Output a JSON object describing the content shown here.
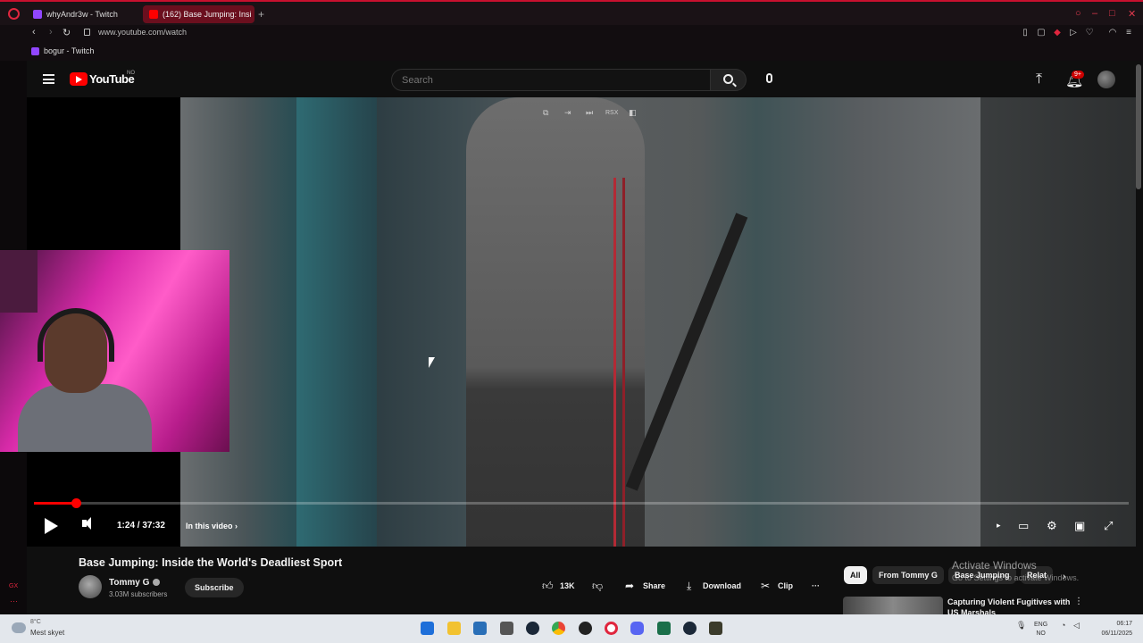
{
  "browser": {
    "tabs": [
      {
        "label": "whyAndr3w - Twitch"
      },
      {
        "label": "(162) Base Jumping: Insi"
      }
    ],
    "new_tab": "+",
    "url": "www.youtube.com/watch",
    "bookmark": "bogur - Twitch",
    "sidebar_gx": "GX",
    "sidebar_more": "···"
  },
  "youtube": {
    "logo_text": "YouTube",
    "country": "NO",
    "search_placeholder": "Search",
    "notif_badge": "9+"
  },
  "player": {
    "overlay_label": "RSX",
    "time": "1:24 / 37:32",
    "chapter": "In this video",
    "progress_fraction": 0.038,
    "accent": "#ff0000"
  },
  "video": {
    "title": "Base Jumping: Inside the World's Deadliest Sport",
    "channel": "Tommy G",
    "subscribers": "3.03M subscribers",
    "subscribe_label": "Subscribe",
    "actions": {
      "likes": "13K",
      "share": "Share",
      "download": "Download",
      "clip": "Clip",
      "more": "···"
    }
  },
  "recommendations": {
    "chips": [
      "All",
      "From Tommy G",
      "Base Jumping",
      "Relat"
    ],
    "first_title": "Capturing Violent Fugitives with US Marshals"
  },
  "watermark": {
    "title": "Activate Windows",
    "subtitle": "Go to Settings to activate Windows."
  },
  "taskbar": {
    "temp": "8°C",
    "weather": "Mest skyet",
    "lang_top": "ENG",
    "lang_bottom": "NO",
    "time": "06:17",
    "date": "06/11/2025"
  }
}
